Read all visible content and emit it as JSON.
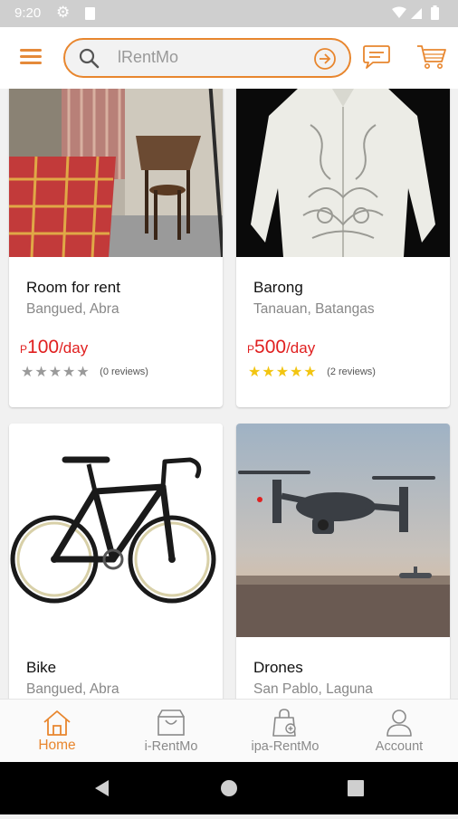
{
  "status_bar": {
    "time": "9:20",
    "icons": [
      "gear-icon",
      "sd-card-icon",
      "wifi-icon",
      "signal-icon",
      "battery-icon"
    ]
  },
  "header": {
    "search_placeholder": "lRentMo",
    "icons": [
      "menu-icon",
      "search-icon",
      "arrow-right-circle-icon",
      "chat-icon",
      "cart-icon"
    ]
  },
  "listings": [
    {
      "title": "Room for rent",
      "location": "Bangued, Abra",
      "currency": "P",
      "price": "100",
      "unit": "/day",
      "rating": 0,
      "reviews": "(0 reviews)"
    },
    {
      "title": "Barong",
      "location": "Tanauan, Batangas",
      "currency": "P",
      "price": "500",
      "unit": "/day",
      "rating": 5,
      "reviews": "(2 reviews)"
    },
    {
      "title": "Bike",
      "location": "Bangued, Abra"
    },
    {
      "title": "Drones",
      "location": "San Pablo, Laguna"
    }
  ],
  "bottom_nav": [
    {
      "label": "Home",
      "icon": "home-icon",
      "active": true
    },
    {
      "label": "i-RentMo",
      "icon": "shop-icon",
      "active": false
    },
    {
      "label": "ipa-RentMo",
      "icon": "bag-add-icon",
      "active": false
    },
    {
      "label": "Account",
      "icon": "user-icon",
      "active": false
    }
  ],
  "colors": {
    "accent": "#e8862e",
    "price": "#e02020",
    "star": "#f2c511",
    "star_empty": "#9a9a9a"
  }
}
